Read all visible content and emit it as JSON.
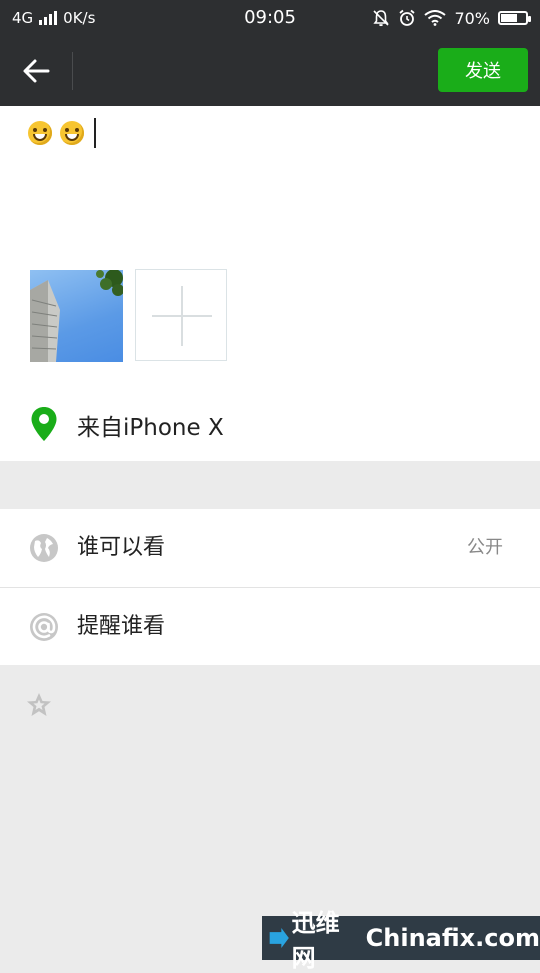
{
  "status_bar": {
    "network": "4G",
    "speed": "0K/s",
    "time": "09:05",
    "battery_percent": "70%",
    "battery_level": 0.7
  },
  "header": {
    "back_icon": "arrow-left-icon",
    "send_label": "发送",
    "send_color": "#1aad19"
  },
  "compose": {
    "emojis": [
      "grinning-emoji",
      "grinning-emoji"
    ],
    "add_photo_icon": "plus-icon"
  },
  "location": {
    "icon": "location-pin-icon",
    "text": "来自iPhone X",
    "icon_color": "#1aad19"
  },
  "settings": [
    {
      "icon": "globe-icon",
      "label": "谁可以看",
      "value": "公开"
    },
    {
      "icon": "at-icon",
      "label": "提醒谁看",
      "value": ""
    }
  ],
  "favorite_icon": "star-icon",
  "watermark": {
    "left_text": "迅维网",
    "right_text": "Chinafix.com"
  }
}
